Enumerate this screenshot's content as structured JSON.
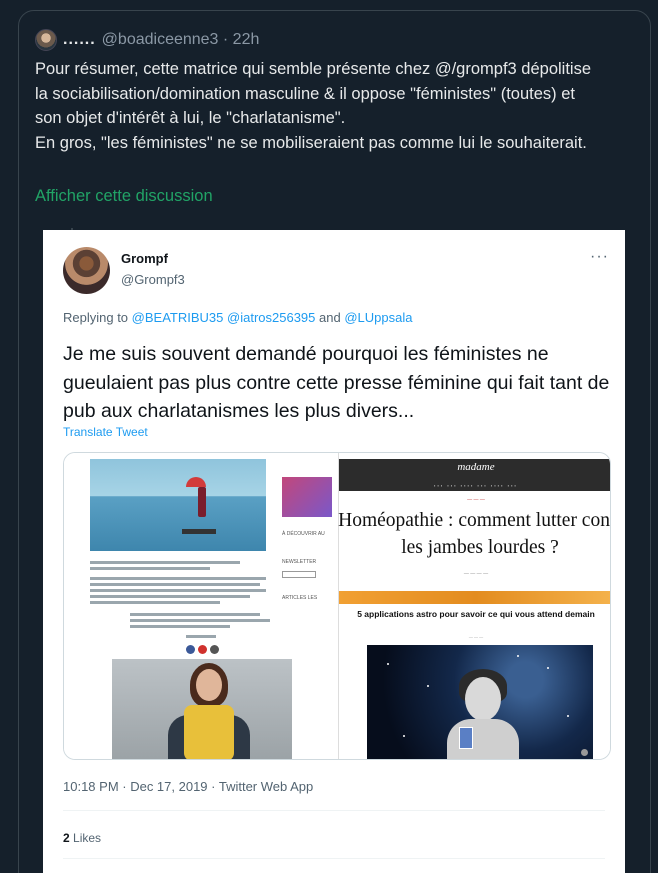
{
  "outer_tweet": {
    "display_name": "......",
    "handle": "@boadiceenne3",
    "time": "22h",
    "text": "Pour résumer, cette matrice qui semble présente chez @/grompf3 dépolitise la sociabilisation/domination masculine & il oppose \"féministes\" (toutes) et son objet d'intérêt à lui, le \"charlatanisme\".\nEn gros, \"les féministes\" ne se mobiliseraient pas comme lui le souhaiterait.",
    "show_thread": "Afficher cette discussion"
  },
  "embedded": {
    "name": "Grompf",
    "handle": "@Grompf3",
    "more": "···",
    "replying_prefix": "Replying to",
    "mentions": [
      "@BEATRIBU35",
      "@iatros256395",
      "@LUppsala"
    ],
    "and_word": "and",
    "text": "Je me suis souvent demandé pourquoi les féministes ne gueulaient pas plus contre cette presse féminine qui fait tant de pub aux charlatanismes les plus divers...",
    "translate": "Translate Tweet",
    "timestamp": "10:18 PM · Dec 17, 2019 · Twitter Web App",
    "likes_count": "2",
    "likes_label": "Likes",
    "media": {
      "left_side_label_1": "À DÉCOUVRIR AU",
      "left_side_label_2": "NEWSLETTER",
      "left_side_label_3": "ARTICLES LES",
      "mag_logo": "madame",
      "mag_headline_1": "Homéopathie : comment lutter contr",
      "mag_headline_2": "les jambes lourdes ?",
      "sub_headline": "5 applications astro pour savoir ce qui vous attend demain"
    }
  }
}
